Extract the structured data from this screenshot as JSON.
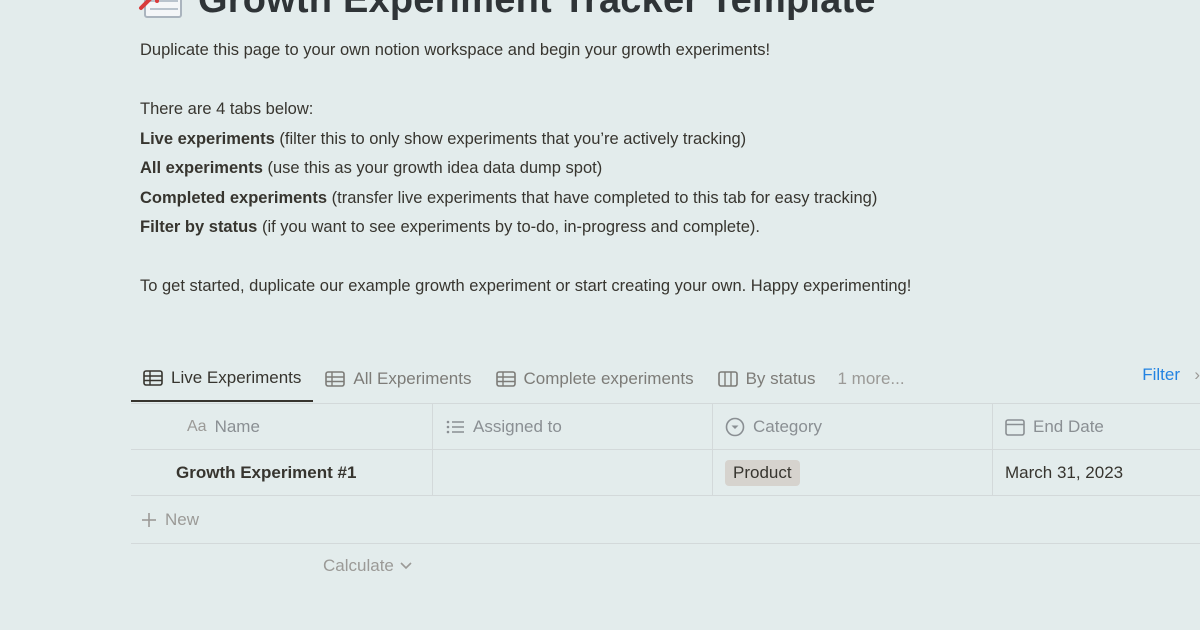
{
  "page": {
    "title": "Growth Experiment Tracker Template",
    "icon": "spreadsheet-arrow-icon"
  },
  "intro": {
    "line1": "Duplicate this page to your own notion workspace and begin your growth experiments!",
    "line2": "There are 4 tabs below:",
    "items": [
      {
        "bold": "Live experiments",
        "rest": " (filter this to only show experiments that you’re actively tracking)"
      },
      {
        "bold": "All experiments",
        "rest": " (use this as your growth idea data dump spot)"
      },
      {
        "bold": "Completed experiments",
        "rest": " (transfer live experiments that have completed to this tab for easy tracking)"
      },
      {
        "bold": "Filter by status",
        "rest": " (if you want to see experiments by to-do, in-progress and complete)."
      }
    ],
    "closing": "To get started, duplicate our example growth experiment or start creating your own. Happy experimenting!"
  },
  "tabs": {
    "items": [
      {
        "label": "Live Experiments",
        "icon": "table-icon",
        "active": true
      },
      {
        "label": "All Experiments",
        "icon": "table-icon",
        "active": false
      },
      {
        "label": "Complete experiments",
        "icon": "table-icon",
        "active": false
      },
      {
        "label": "By status",
        "icon": "board-icon",
        "active": false
      }
    ],
    "more": "1 more...",
    "filter": "Filter"
  },
  "table": {
    "columns": [
      {
        "label": "Name",
        "icon": "text-aa-icon"
      },
      {
        "label": "Assigned to",
        "icon": "list-icon"
      },
      {
        "label": "Category",
        "icon": "select-circle-icon"
      },
      {
        "label": "End Date",
        "icon": "calendar-icon"
      }
    ],
    "name_prefix": "Aa",
    "rows": [
      {
        "name": "Growth Experiment #1",
        "assigned": "",
        "category": "Product",
        "end_date": "March 31, 2023"
      }
    ],
    "new_label": "New",
    "calculate_label": "Calculate"
  },
  "colors": {
    "background": "#e3ecec",
    "accent": "#2383e2",
    "tag_bg": "#d6d3ce"
  }
}
